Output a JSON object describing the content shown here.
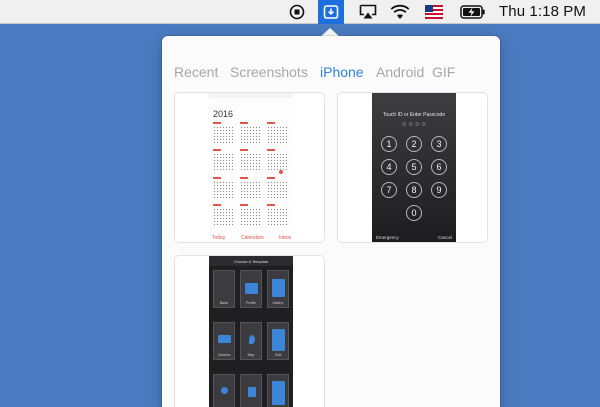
{
  "menubar": {
    "clock": "Thu 1:18 PM",
    "icons": [
      "stop-record-icon",
      "screenshot-tray-icon",
      "airplay-icon",
      "wifi-icon",
      "us-flag-icon",
      "battery-charging-icon"
    ]
  },
  "popover": {
    "tabs": [
      {
        "label": "Recent",
        "active": false
      },
      {
        "label": "Screenshots",
        "active": false
      },
      {
        "label": "iPhone",
        "active": true
      },
      {
        "label": "Android",
        "active": false
      },
      {
        "label": "GIF",
        "active": false
      }
    ],
    "thumbnails": {
      "calendar": {
        "year": "2016",
        "footer": [
          "Today",
          "Calendars",
          "Inbox"
        ]
      },
      "passcode": {
        "title": "Touch ID or Enter Passcode",
        "keys": [
          "1",
          "2",
          "3",
          "4",
          "5",
          "6",
          "7",
          "8",
          "9",
          "0"
        ],
        "footer_left": "Emergency",
        "footer_right": "Cancel"
      },
      "template": {
        "title": "Choose A Template",
        "tiles": [
          "Basic",
          "Profile",
          "Gallery",
          "Camera",
          "Map",
          "Grid",
          "",
          "",
          ""
        ]
      }
    }
  },
  "colors": {
    "desktop": "#4a7bc0",
    "accent": "#2f82e0",
    "tab_inactive": "#a6a6a6",
    "calendar_red": "#e4554a"
  }
}
